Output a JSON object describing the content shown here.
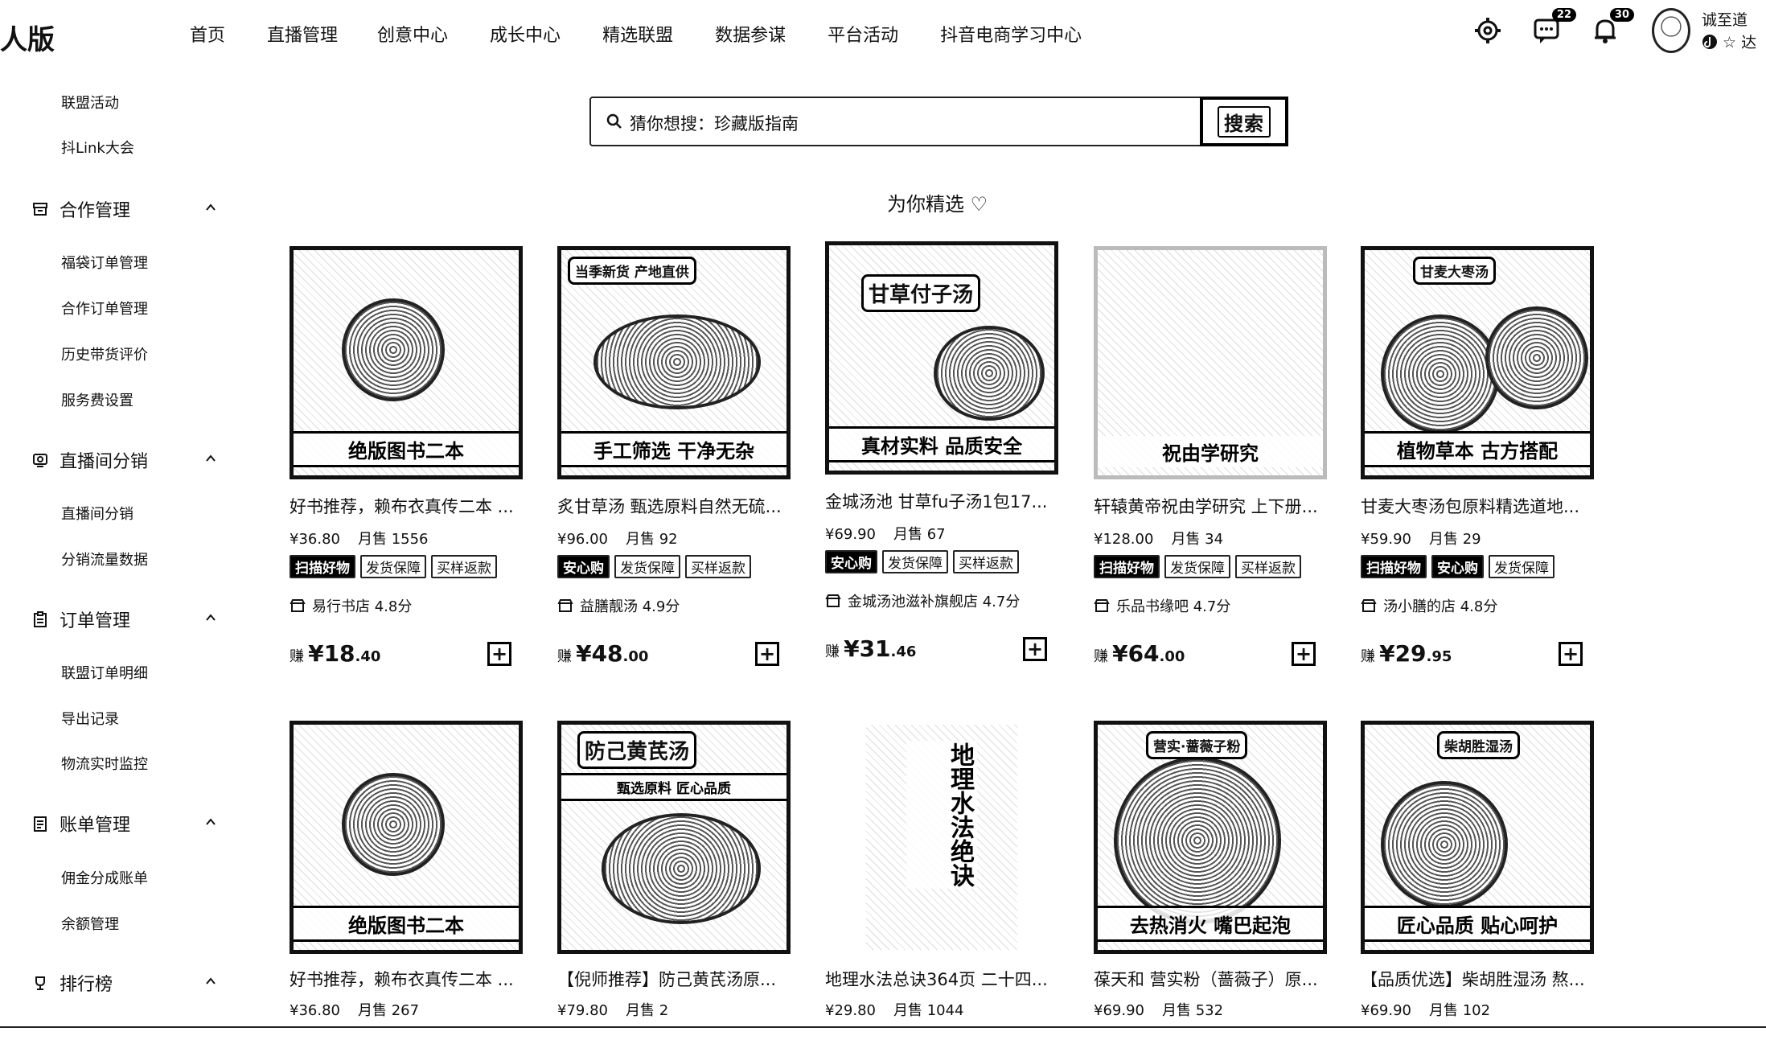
{
  "brand": "人版",
  "topnav": [
    "首页",
    "直播管理",
    "创意中心",
    "成长中心",
    "精选联盟",
    "数据参谋",
    "平台活动",
    "抖音电商学习中心"
  ],
  "header_badges": {
    "messages": "22",
    "notifications": "30"
  },
  "user": {
    "name": "诚至道",
    "sub": "☆ 达"
  },
  "sidebar": {
    "top_items": [
      "联盟活动",
      "抖Link大会"
    ],
    "groups": [
      {
        "title": "合作管理",
        "icon": "archive-icon",
        "items": [
          "福袋订单管理",
          "合作订单管理",
          "历史带货评价",
          "服务费设置"
        ]
      },
      {
        "title": "直播间分销",
        "icon": "live-icon",
        "items": [
          "直播间分销",
          "分销流量数据"
        ]
      },
      {
        "title": "订单管理",
        "icon": "clipboard-icon",
        "items": [
          "联盟订单明细",
          "导出记录",
          "物流实时监控"
        ]
      },
      {
        "title": "账单管理",
        "icon": "bill-icon",
        "items": [
          "佣金分成账单",
          "余额管理"
        ]
      },
      {
        "title": "排行榜",
        "icon": "trophy-icon",
        "items": []
      }
    ]
  },
  "search": {
    "placeholder_text": "猜你想搜：珍藏版指南",
    "button": "搜索"
  },
  "section_title": "为你精选 ♡",
  "products": [
    {
      "img_text": "绝版图书二本",
      "img_tag": "",
      "title": "好书推荐，赖布衣真传二本 ...",
      "price": "¥36.80",
      "sold": "月售 1556",
      "badges": [
        "扫描好物",
        "发货保障",
        "买样返款"
      ],
      "shop": "易行书店 4.8分",
      "earn_label": "赚",
      "earn_int": "¥18",
      "earn_dec": ".40"
    },
    {
      "img_text": "手工筛选 干净无杂",
      "img_tag": "当季新货 产地直供",
      "title": "炙甘草汤 甄选原料自然无硫...",
      "price": "¥96.00",
      "sold": "月售 92",
      "badges": [
        "安心购",
        "发货保障",
        "买样返款"
      ],
      "shop": "益膳靓汤 4.9分",
      "earn_label": "赚",
      "earn_int": "¥48",
      "earn_dec": ".00"
    },
    {
      "img_text": "真材实料 品质安全",
      "img_tag": "甘草付子汤",
      "title": "金城汤池 甘草fu子汤1包17...",
      "price": "¥69.90",
      "sold": "月售 67",
      "badges": [
        "安心购",
        "发货保障",
        "买样返款"
      ],
      "shop": "金城汤池滋补旗舰店 4.7分",
      "earn_label": "赚",
      "earn_int": "¥31",
      "earn_dec": ".46"
    },
    {
      "img_text": "祝由学研究",
      "img_tag": "",
      "title": "轩辕黄帝祝由学研究 上下册...",
      "price": "¥128.00",
      "sold": "月售 34",
      "badges": [
        "扫描好物",
        "发货保障",
        "买样返款"
      ],
      "shop": "乐品书缘吧 4.7分",
      "earn_label": "赚",
      "earn_int": "¥64",
      "earn_dec": ".00"
    },
    {
      "img_text": "植物草本 古方搭配",
      "img_tag": "甘麦大枣汤",
      "title": "甘麦大枣汤包原料精选道地...",
      "price": "¥59.90",
      "sold": "月售 29",
      "badges": [
        "扫描好物",
        "安心购",
        "发货保障"
      ],
      "shop": "汤小膳的店 4.8分",
      "earn_label": "赚",
      "earn_int": "¥29",
      "earn_dec": ".95"
    },
    {
      "img_text": "绝版图书二本",
      "img_tag": "",
      "title": "好书推荐，赖布衣真传二本 ...",
      "price": "¥36.80",
      "sold": "月售 267"
    },
    {
      "img_text": "甄选原料 匠心品质",
      "img_tag": "防己黄芪汤",
      "title": "【倪师推荐】防己黄芪汤原...",
      "price": "¥79.80",
      "sold": "月售 2"
    },
    {
      "img_text": "地理水法绝诀",
      "img_tag": "",
      "title": "地理水法总诀364页 二十四...",
      "price": "¥29.80",
      "sold": "月售 1044"
    },
    {
      "img_text": "去热消火 嘴巴起泡",
      "img_tag": "营实·蔷薇子粉",
      "title": "葆天和 营实粉（蔷薇子）原...",
      "price": "¥69.90",
      "sold": "月售 532"
    },
    {
      "img_text": "匠心品质 贴心呵护",
      "img_tag": "柴胡胜湿汤",
      "title": "【品质优选】柴胡胜湿汤 熬...",
      "price": "¥69.90",
      "sold": "月售 102"
    }
  ]
}
